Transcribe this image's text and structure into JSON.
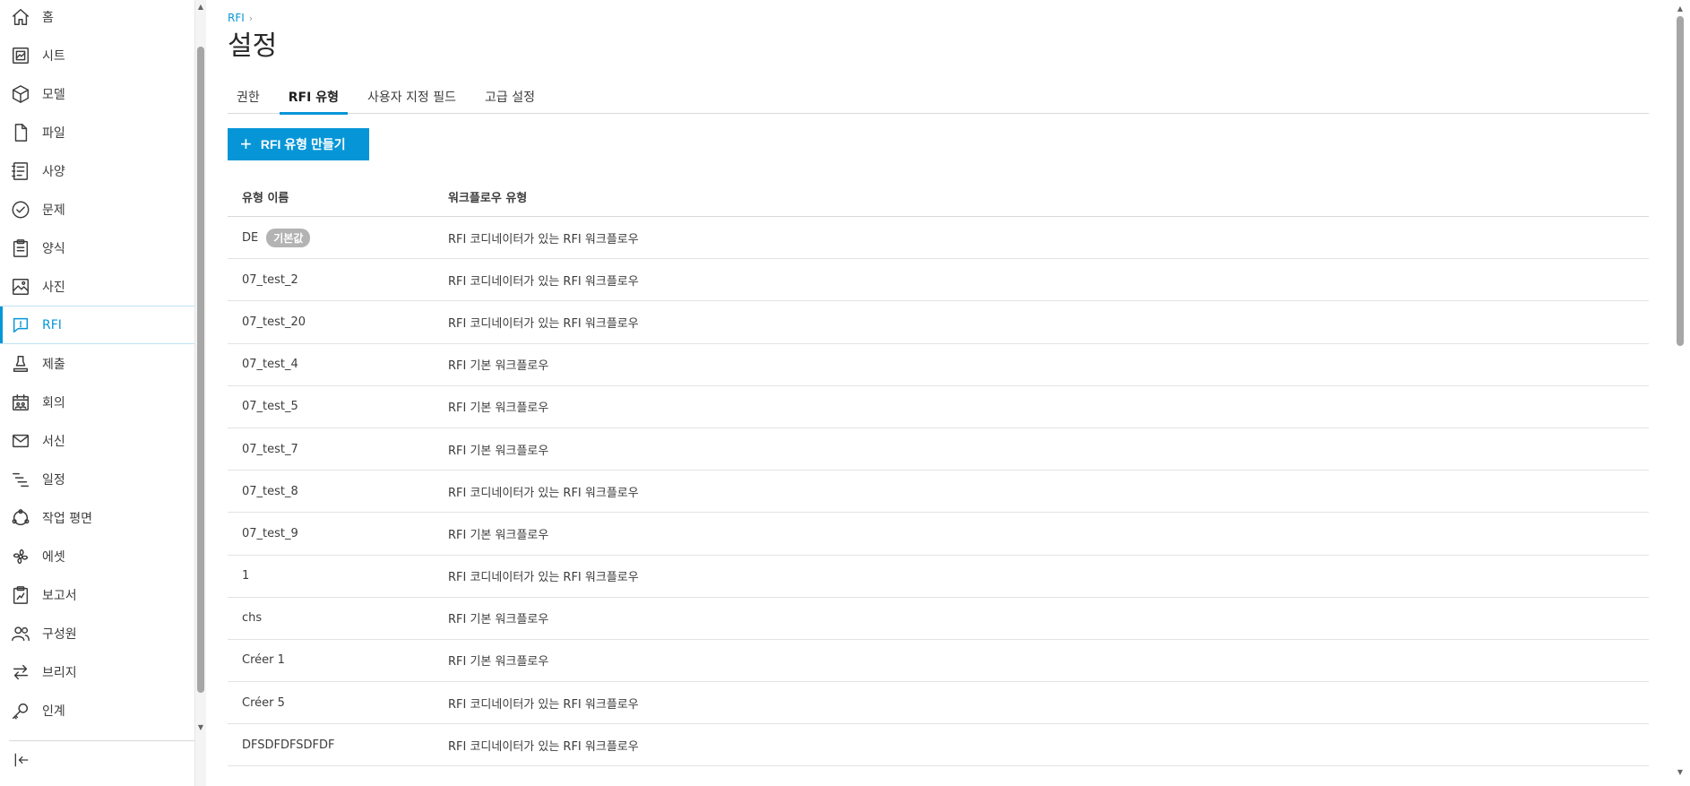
{
  "sidebar": {
    "items": [
      {
        "label": "홈",
        "icon": "home-icon"
      },
      {
        "label": "시트",
        "icon": "sheet-icon"
      },
      {
        "label": "모델",
        "icon": "cube-icon"
      },
      {
        "label": "파일",
        "icon": "file-icon"
      },
      {
        "label": "사양",
        "icon": "spec-icon"
      },
      {
        "label": "문제",
        "icon": "check-circle-icon"
      },
      {
        "label": "양식",
        "icon": "clipboard-icon"
      },
      {
        "label": "사진",
        "icon": "photo-icon"
      },
      {
        "label": "RFI",
        "icon": "rfi-icon",
        "active": true
      },
      {
        "label": "제출",
        "icon": "stamp-icon"
      },
      {
        "label": "회의",
        "icon": "meeting-icon"
      },
      {
        "label": "서신",
        "icon": "mail-icon"
      },
      {
        "label": "일정",
        "icon": "schedule-icon"
      },
      {
        "label": "작업 평면",
        "icon": "work-plane-icon"
      },
      {
        "label": "에셋",
        "icon": "asset-icon"
      },
      {
        "label": "보고서",
        "icon": "report-icon"
      },
      {
        "label": "구성원",
        "icon": "members-icon"
      },
      {
        "label": "브리지",
        "icon": "bridge-icon"
      },
      {
        "label": "인계",
        "icon": "key-icon"
      }
    ],
    "collapse_icon": "collapse-sidebar-icon"
  },
  "breadcrumb": {
    "parent": "RFI",
    "separator": "›"
  },
  "page": {
    "title": "설정"
  },
  "tabs": [
    {
      "label": "권한"
    },
    {
      "label": "RFI 유형",
      "active": true
    },
    {
      "label": "사용자 지정 필드"
    },
    {
      "label": "고급 설정"
    }
  ],
  "create_button": {
    "label": "RFI 유형 만들기",
    "icon": "plus-icon"
  },
  "table": {
    "headers": {
      "name": "유형 이름",
      "workflow": "워크플로우 유형"
    },
    "default_badge": "기본값",
    "rows": [
      {
        "name": "DE",
        "workflow": "RFI 코디네이터가 있는 RFI 워크플로우"
      },
      {
        "name": "07_test_2",
        "workflow": "RFI 코디네이터가 있는 RFI 워크플로우"
      },
      {
        "name": "07_test_20",
        "workflow": "RFI 코디네이터가 있는 RFI 워크플로우"
      },
      {
        "name": "07_test_4",
        "workflow": "RFI 기본 워크플로우"
      },
      {
        "name": "07_test_5",
        "workflow": "RFI 기본 워크플로우"
      },
      {
        "name": "07_test_7",
        "workflow": "RFI 기본 워크플로우"
      },
      {
        "name": "07_test_8",
        "workflow": "RFI 코디네이터가 있는 RFI 워크플로우"
      },
      {
        "name": "07_test_9",
        "workflow": "RFI 기본 워크플로우"
      },
      {
        "name": "1",
        "workflow": "RFI 코디네이터가 있는 RFI 워크플로우"
      },
      {
        "name": "chs",
        "workflow": "RFI 기본 워크플로우"
      },
      {
        "name": "Créer 1",
        "workflow": "RFI 기본 워크플로우"
      },
      {
        "name": "Créer 5",
        "workflow": "RFI 코디네이터가 있는 RFI 워크플로우"
      },
      {
        "name": "DFSDFDFSDFDF",
        "workflow": "RFI 코디네이터가 있는 RFI 워크플로우"
      }
    ]
  },
  "colors": {
    "accent": "#0696d7",
    "badge": "#b3b3b3",
    "text": "#3c3c3c"
  }
}
